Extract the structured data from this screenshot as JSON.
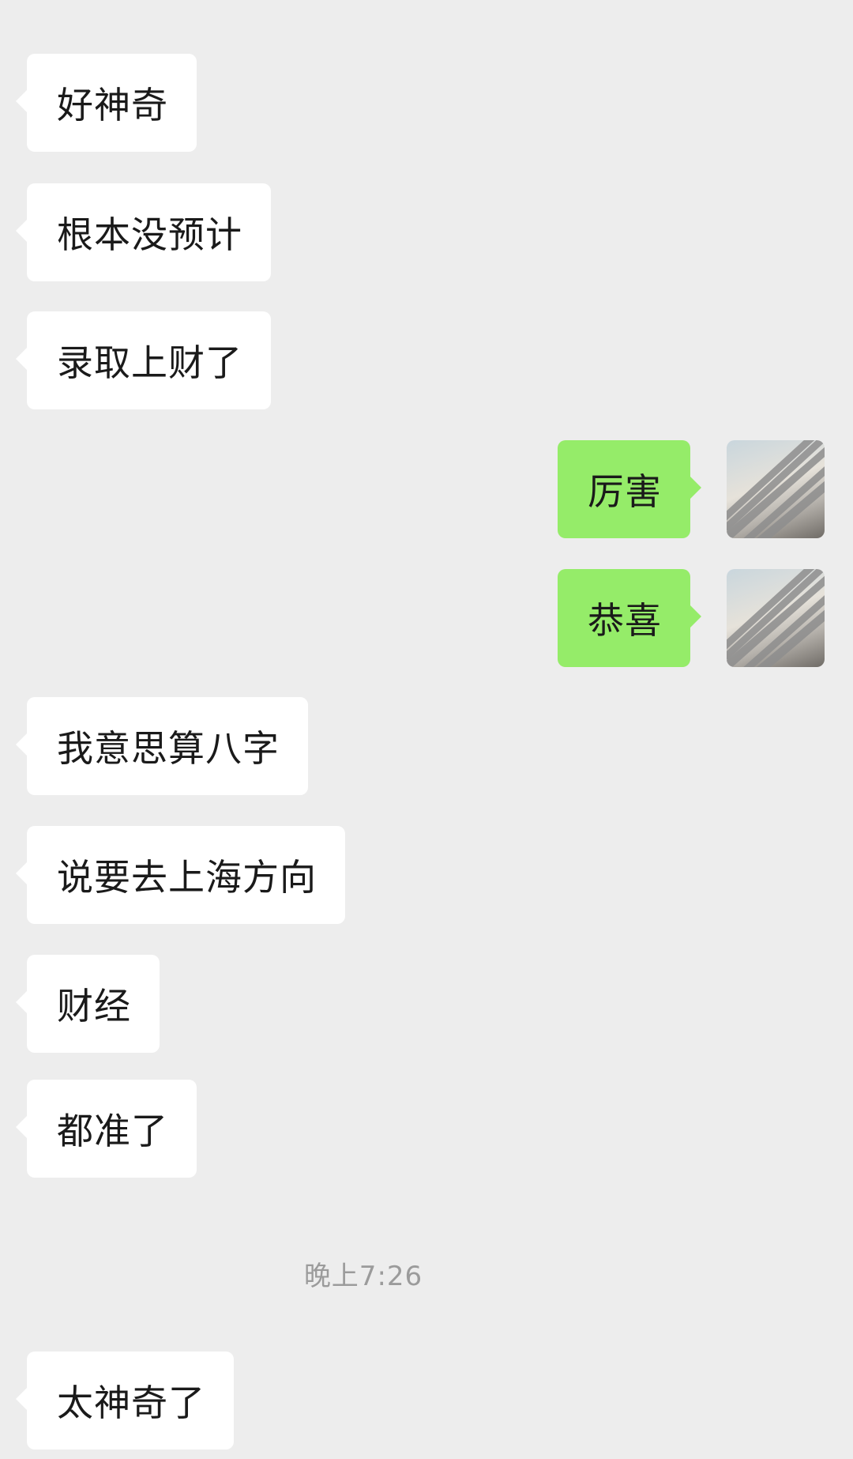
{
  "messages": [
    {
      "side": "in",
      "text": "好神奇"
    },
    {
      "side": "in",
      "text": "根本没预计"
    },
    {
      "side": "in",
      "text": "录取上财了"
    },
    {
      "side": "out",
      "text": "厉害"
    },
    {
      "side": "out",
      "text": "恭喜"
    },
    {
      "side": "in",
      "text": "我意思算八字"
    },
    {
      "side": "in",
      "text": "说要去上海方向"
    },
    {
      "side": "in",
      "text": "财经"
    },
    {
      "side": "in",
      "text": "都准了"
    },
    {
      "side": "in",
      "text": "太神奇了"
    }
  ],
  "timestamp": "晚上7:26",
  "colors": {
    "background": "#ededed",
    "incoming_bubble": "#ffffff",
    "outgoing_bubble": "#95ec69",
    "timestamp_text": "#9b9b9b"
  },
  "icons": {
    "avatar": "blurred-user-avatar"
  }
}
